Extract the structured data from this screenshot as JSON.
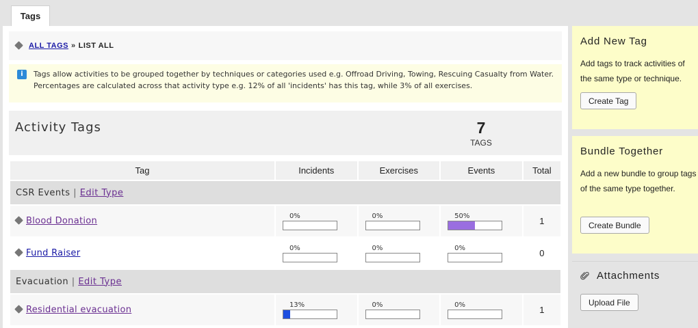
{
  "tabs": {
    "active": "Tags"
  },
  "breadcrumb": {
    "root": "ALL TAGS",
    "separator": "»",
    "current": "LIST ALL"
  },
  "info": {
    "text": "Tags allow activities to be grouped together by techniques or categories used e.g. Offroad Driving, Towing, Rescuing Casualty from Water. Percentages are calculated across that activity type e.g. 12% of all 'incidents' has this tag, while 3% of all exercises."
  },
  "activity": {
    "title": "Activity Tags",
    "count": "7",
    "count_label": "TAGS"
  },
  "table": {
    "columns": [
      "Tag",
      "Incidents",
      "Exercises",
      "Events",
      "Total"
    ],
    "groups": [
      {
        "name": "CSR Events",
        "edit_label": "Edit Type",
        "rows": [
          {
            "tag": "Blood Donation",
            "incidents": "0%",
            "incidents_fill": 0,
            "exercises": "0%",
            "exercises_fill": 0,
            "events": "50%",
            "events_fill": 50,
            "total": "1"
          },
          {
            "tag": "Fund Raiser",
            "incidents": "0%",
            "incidents_fill": 0,
            "exercises": "0%",
            "exercises_fill": 0,
            "events": "0%",
            "events_fill": 0,
            "total": "0"
          }
        ]
      },
      {
        "name": "Evacuation",
        "edit_label": "Edit Type",
        "rows": [
          {
            "tag": "Residential evacuation",
            "incidents": "13%",
            "incidents_fill": 13,
            "exercises": "0%",
            "exercises_fill": 0,
            "events": "0%",
            "events_fill": 0,
            "total": "1"
          }
        ]
      }
    ]
  },
  "sidebar": {
    "add_tag": {
      "title": "Add New Tag",
      "text": "Add tags to track activities of the same type or technique.",
      "button": "Create Tag"
    },
    "bundle": {
      "title": "Bundle Together",
      "text": "Add a new bundle to group tags of the same type together.",
      "button": "Create Bundle"
    },
    "attachments": {
      "title": "Attachments",
      "button": "Upload File"
    }
  },
  "colors": {
    "events_bar": "#9a6ee0",
    "incidents_bar": "#1e4fe0",
    "note_bg": "#fdfdc9",
    "link": "#1a1aa6",
    "visited_link": "#6a2f91"
  },
  "icons": [
    "tag-icon",
    "info-icon",
    "paperclip-icon"
  ]
}
